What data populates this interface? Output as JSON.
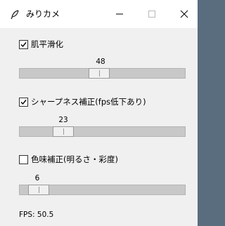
{
  "window": {
    "title": "みりカメ",
    "icon": "feather-icon"
  },
  "controls": [
    {
      "label": "肌平滑化",
      "checked": true,
      "slider_value": "48",
      "slider_fraction": 0.48
    },
    {
      "label": "シャープネス補正(fps低下あり)",
      "checked": true,
      "slider_value": "23",
      "slider_fraction": 0.23
    },
    {
      "label": "色味補正(明るさ・彩度)",
      "checked": false,
      "slider_value": "6",
      "slider_fraction": 0.06
    }
  ],
  "status": {
    "fps_text": "FPS: 50.5"
  },
  "colors": {
    "titlebar": "#ffffff",
    "window_bg": "#f0f0f0",
    "trough": "#c8c8c8"
  }
}
